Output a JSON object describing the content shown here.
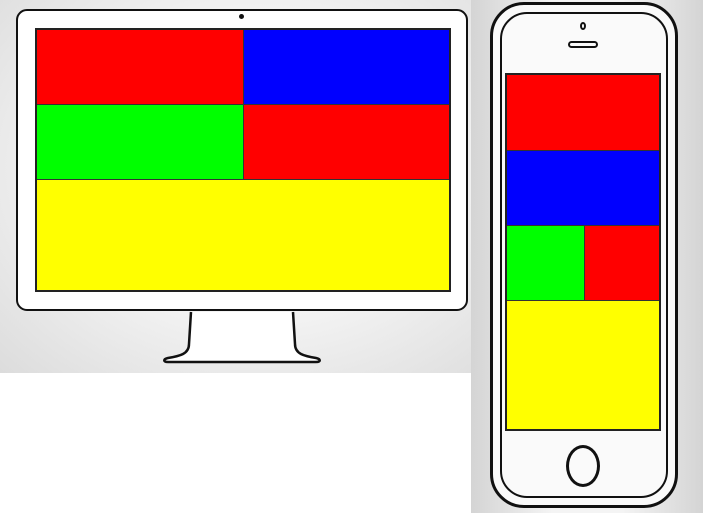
{
  "colors": {
    "red": "#ff0000",
    "blue": "#0000ff",
    "green": "#00ff00",
    "yellow": "#ffff00",
    "outline": "#111111"
  },
  "desktop_layout": {
    "device": "monitor-icon",
    "rows": [
      [
        "red",
        "blue"
      ],
      [
        "green",
        "red"
      ],
      [
        "yellow"
      ]
    ]
  },
  "mobile_layout": {
    "device": "smartphone-icon",
    "rows": [
      [
        "red"
      ],
      [
        "blue"
      ],
      [
        "green",
        "red"
      ],
      [
        "yellow"
      ]
    ]
  }
}
